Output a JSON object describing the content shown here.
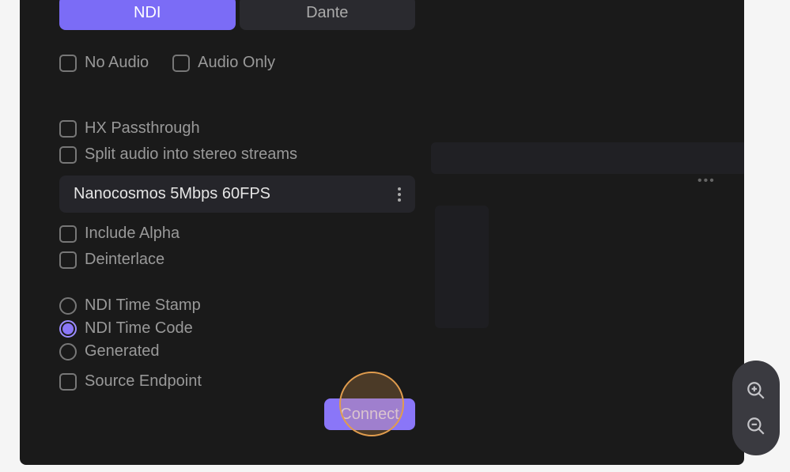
{
  "tabs": {
    "ndi": "NDI",
    "dante": "Dante"
  },
  "checkboxes": {
    "no_audio": "No Audio",
    "audio_only": "Audio Only",
    "hx_passthrough": "HX Passthrough",
    "split_audio": "Split audio into stereo streams",
    "include_alpha": "Include Alpha",
    "deinterlace": "Deinterlace",
    "source_endpoint": "Source Endpoint"
  },
  "select": {
    "value": "Nanocosmos 5Mbps 60FPS"
  },
  "radios": {
    "ndi_timestamp": "NDI Time Stamp",
    "ndi_timecode": "NDI Time Code",
    "generated": "Generated"
  },
  "buttons": {
    "connect": "Connect"
  },
  "bg": {
    "dots": "•••"
  }
}
